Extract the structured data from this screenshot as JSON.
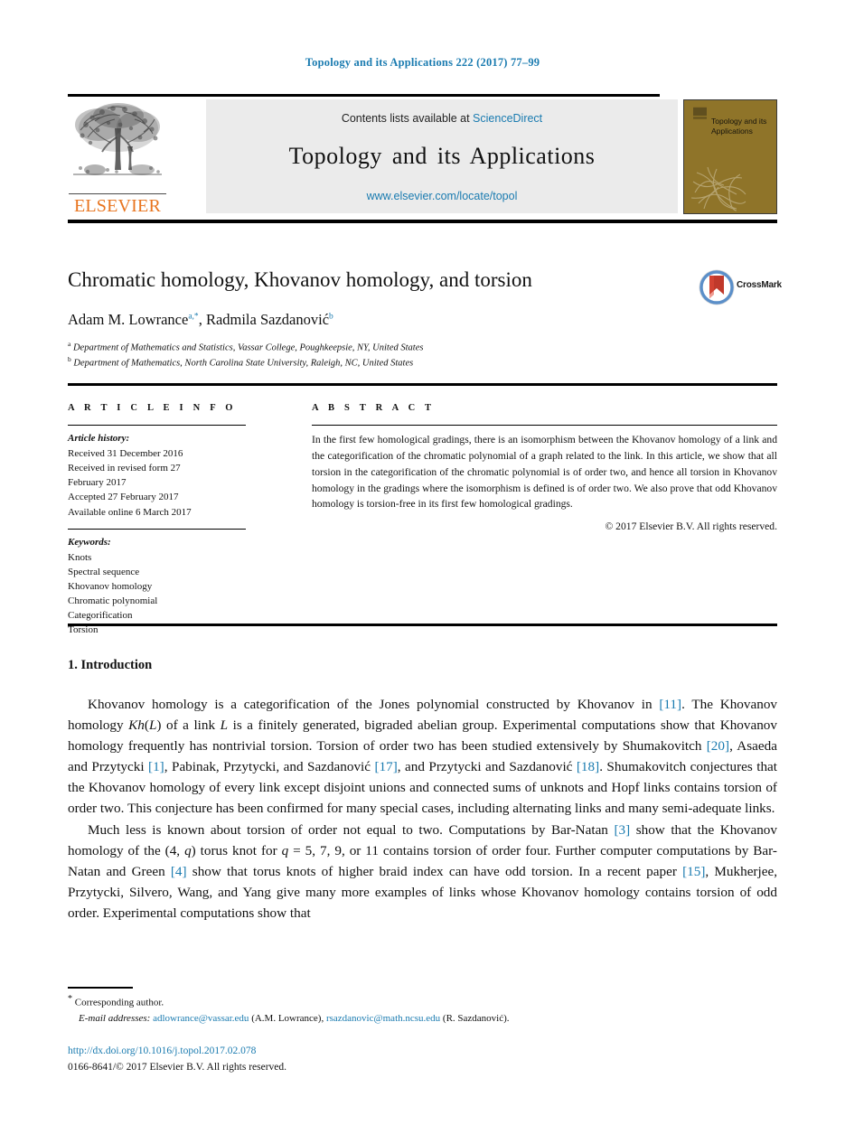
{
  "running_head": "Topology and its Applications 222 (2017) 77–99",
  "masthead": {
    "contents_prefix": "Contents lists available at ",
    "sciencedirect": "ScienceDirect",
    "journal_title": "Topology and its Applications",
    "url": "www.elsevier.com/locate/topol",
    "publisher_wordmark": "ELSEVIER",
    "cover_title": "Topology and its Applications"
  },
  "article": {
    "title": "Chromatic homology, Khovanov homology, and torsion",
    "authors_html": "Adam M. Lowrance<sup>a,*</sup>, Radmila Sazdanović<sup>b</sup>",
    "affiliation_a": "Department of Mathematics and Statistics, Vassar College, Poughkeepsie, NY, United States",
    "affiliation_b": "Department of Mathematics, North Carolina State University, Raleigh, NC, United States",
    "crossmark_label": "CrossMark"
  },
  "info": {
    "heading": "A R T I C L E   I N F O",
    "history_label": "Article history:",
    "history": [
      "Received 31 December 2016",
      "Received in revised form 27",
      "February 2017",
      "Accepted 27 February 2017",
      "Available online 6 March 2017"
    ],
    "keywords_label": "Keywords:",
    "keywords": [
      "Knots",
      "Spectral sequence",
      "Khovanov homology",
      "Chromatic polynomial",
      "Categorification",
      "Torsion"
    ]
  },
  "abstract": {
    "heading": "A B S T R A C T",
    "text": "In the first few homological gradings, there is an isomorphism between the Khovanov homology of a link and the categorification of the chromatic polynomial of a graph related to the link. In this article, we show that all torsion in the categorification of the chromatic polynomial is of order two, and hence all torsion in Khovanov homology in the gradings where the isomorphism is defined is of order two. We also prove that odd Khovanov homology is torsion-free in its first few homological gradings.",
    "copyright": "© 2017 Elsevier B.V. All rights reserved."
  },
  "body": {
    "section_heading": "1. Introduction",
    "paragraph_1_html": "Khovanov homology is a categorification of the Jones polynomial constructed by Khovanov in <span class=\"cite\">[11]</span>. The Khovanov homology <span class=\"mathit\">Kh</span>(<span class=\"mathit\">L</span>) of a link <span class=\"mathit\">L</span> is a finitely generated, bigraded abelian group. Experimental computations show that Khovanov homology frequently has nontrivial torsion. Torsion of order two has been studied extensively by Shumakovitch <span class=\"cite\">[20]</span>, Asaeda and Przytycki <span class=\"cite\">[1]</span>, Pabinak, Przytycki, and Sazdanović <span class=\"cite\">[17]</span>, and Przytycki and Sazdanović <span class=\"cite\">[18]</span>. Shumakovitch conjectures that the Khovanov homology of every link except disjoint unions and connected sums of unknots and Hopf links contains torsion of order two. This conjecture has been confirmed for many special cases, including alternating links and many semi-adequate links.",
    "paragraph_2_html": "Much less is known about torsion of order not equal to two. Computations by Bar-Natan <span class=\"cite\">[3]</span> show that the Khovanov homology of the (4, <span class=\"mathit\">q</span>) torus knot for <span class=\"mathit\">q</span> = 5, 7, 9, or 11 contains torsion of order four. Further computer computations by Bar-Natan and Green <span class=\"cite\">[4]</span> show that torus knots of higher braid index can have odd torsion. In a recent paper <span class=\"cite\">[15]</span>, Mukherjee, Przytycki, Silvero, Wang, and Yang give many more examples of links whose Khovanov homology contains torsion of odd order. Experimental computations show that"
  },
  "footer": {
    "corresponding_marker": "*",
    "corresponding_text": "Corresponding author.",
    "email_label": "E-mail addresses:",
    "email_1": "adlowrance@vassar.edu",
    "email_1_owner": "(A.M. Lowrance),",
    "email_2": "rsazdanovic@math.ncsu.edu",
    "email_2_owner": "(R. Sazdanović).",
    "doi": "http://dx.doi.org/10.1016/j.topol.2017.02.078",
    "imprint": "0166-8641/© 2017 Elsevier B.V. All rights reserved."
  },
  "colors": {
    "link_blue": "#1a7bb0",
    "elsevier_orange": "#e8741e",
    "cover_olive": "#8f7429",
    "mast_gray": "#ebebeb"
  }
}
